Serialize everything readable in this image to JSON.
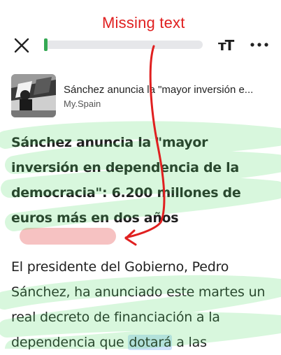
{
  "toolbar": {
    "close_icon": "close-icon",
    "text_size_icon": "text-size-icon",
    "text_size_glyph": "тT",
    "menu_icon": "more-vert-icon",
    "progress": 0.02
  },
  "annotation": {
    "label": "Missing text"
  },
  "source": {
    "title": "Sánchez anuncia la \"mayor inversión e...",
    "site": "My.Spain"
  },
  "article": {
    "headline": "Sánchez anuncia la \"mayor inversión en dependencia de la democracia\": 6.200 millones de euros más en dos años",
    "body_part1": "El presidente del Gobierno, Pedro Sánchez, ha anunciado este martes un real decreto de financiación a la dependencia que ",
    "body_highlight": "dotará",
    "body_part2": " a las"
  },
  "colors": {
    "accent_green": "#34a853",
    "annotation_red": "#e02020",
    "placeholder_pink": "#f4b7b7",
    "scribble_green": "#4cd964",
    "highlight_blue": "#cfe3fb"
  }
}
